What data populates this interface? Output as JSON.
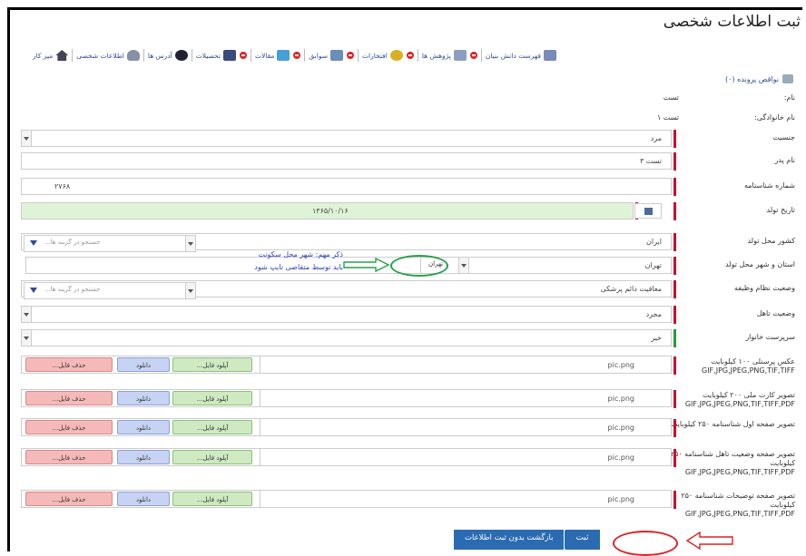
{
  "page_title": "ثبت اطلاعات شخصی",
  "nav": [
    {
      "label": "میز کار",
      "icon": "home-icon"
    },
    {
      "label": "اطلاعات شخصی",
      "icon": "user-icon"
    },
    {
      "label": "آدرس ها",
      "icon": "address-icon"
    },
    {
      "label": "تحصیلات",
      "icon": "education-icon"
    },
    {
      "label": "مقالات",
      "icon": "articles-icon"
    },
    {
      "label": "سوابق",
      "icon": "records-icon"
    },
    {
      "label": "افتخارات",
      "icon": "award-icon"
    },
    {
      "label": "پژوهش ها",
      "icon": "research-icon"
    },
    {
      "label": "فهرست دانش بنیان",
      "icon": "students-icon"
    }
  ],
  "cv_link": "نواقص پرونده (۰)",
  "fields": {
    "first_name": {
      "label": "نام:",
      "value": "تست"
    },
    "last_name": {
      "label": "نام خانوادگی:",
      "value": "تست ۱"
    },
    "gender": {
      "label": "جنسیت",
      "value": "مرد"
    },
    "father_name": {
      "label": "نام پدر",
      "value": "تست ۳"
    },
    "national_id": {
      "label": "شماره شناسنامه",
      "value": "۲۷۶۸"
    },
    "birth_date": {
      "label": "تاریخ تولد",
      "value": "۱۳۶۵/۱۰/۱۶"
    },
    "birth_country": {
      "label": "کشور محل تولد",
      "value": "ایران",
      "search_placeholder": "جستجو در گزینه ها..."
    },
    "birth_city": {
      "label": "استان و شهر محل تولد",
      "value": "تهران",
      "chosen": "تهران"
    },
    "workplace": {
      "label": "وضعیت نظام وظیفه",
      "value": "معافیت دائم پزشکی",
      "search_placeholder": "جستجو در گزینه ها..."
    },
    "marital": {
      "label": "وضعیت تاهل",
      "value": "مجرد"
    },
    "guardian": {
      "label": "سرپرست خانوار",
      "value": "خیر"
    }
  },
  "annotation": {
    "line1": "ذکر مهم: شهر محل سکونت",
    "line2": "باید توسط متقاضی تایپ شود"
  },
  "uploads": [
    {
      "label": "عکس پرسنلی ۱۰۰ کیلوبایت GIF,JPG,JPEG,PNG,TIF,TIFF",
      "file": "pic.png"
    },
    {
      "label": "تصویر کارت ملی ۲۰۰ کیلوبایت GIF,JPG,JPEG,PNG,TIF,TIFF,PDF",
      "file": "pic.png"
    },
    {
      "label": "تصویر صفحه اول شناسنامه ۲۵۰ کیلوبایت",
      "file": "pic.png"
    },
    {
      "label": "تصویر صفحه وضعیت تاهل شناسنامه ۲۵۰ کیلوبایت GIF,JPG,JPEG,PNG,TIF,TIFF,PDF",
      "file": "pic.png"
    },
    {
      "label": "تصویر صفحه توضیحات شناسنامه ۲۵۰ کیلوبایت GIF,JPG,JPEG,PNG,TIF,TIFF,PDF",
      "file": "pic.png"
    }
  ],
  "buttons": {
    "upload": "آپلود فایل...",
    "download": "دانلود",
    "delete": "حذف فایل...",
    "submit": "ثبت",
    "back": "بازگشت بدون ثبت اطلاعات"
  }
}
